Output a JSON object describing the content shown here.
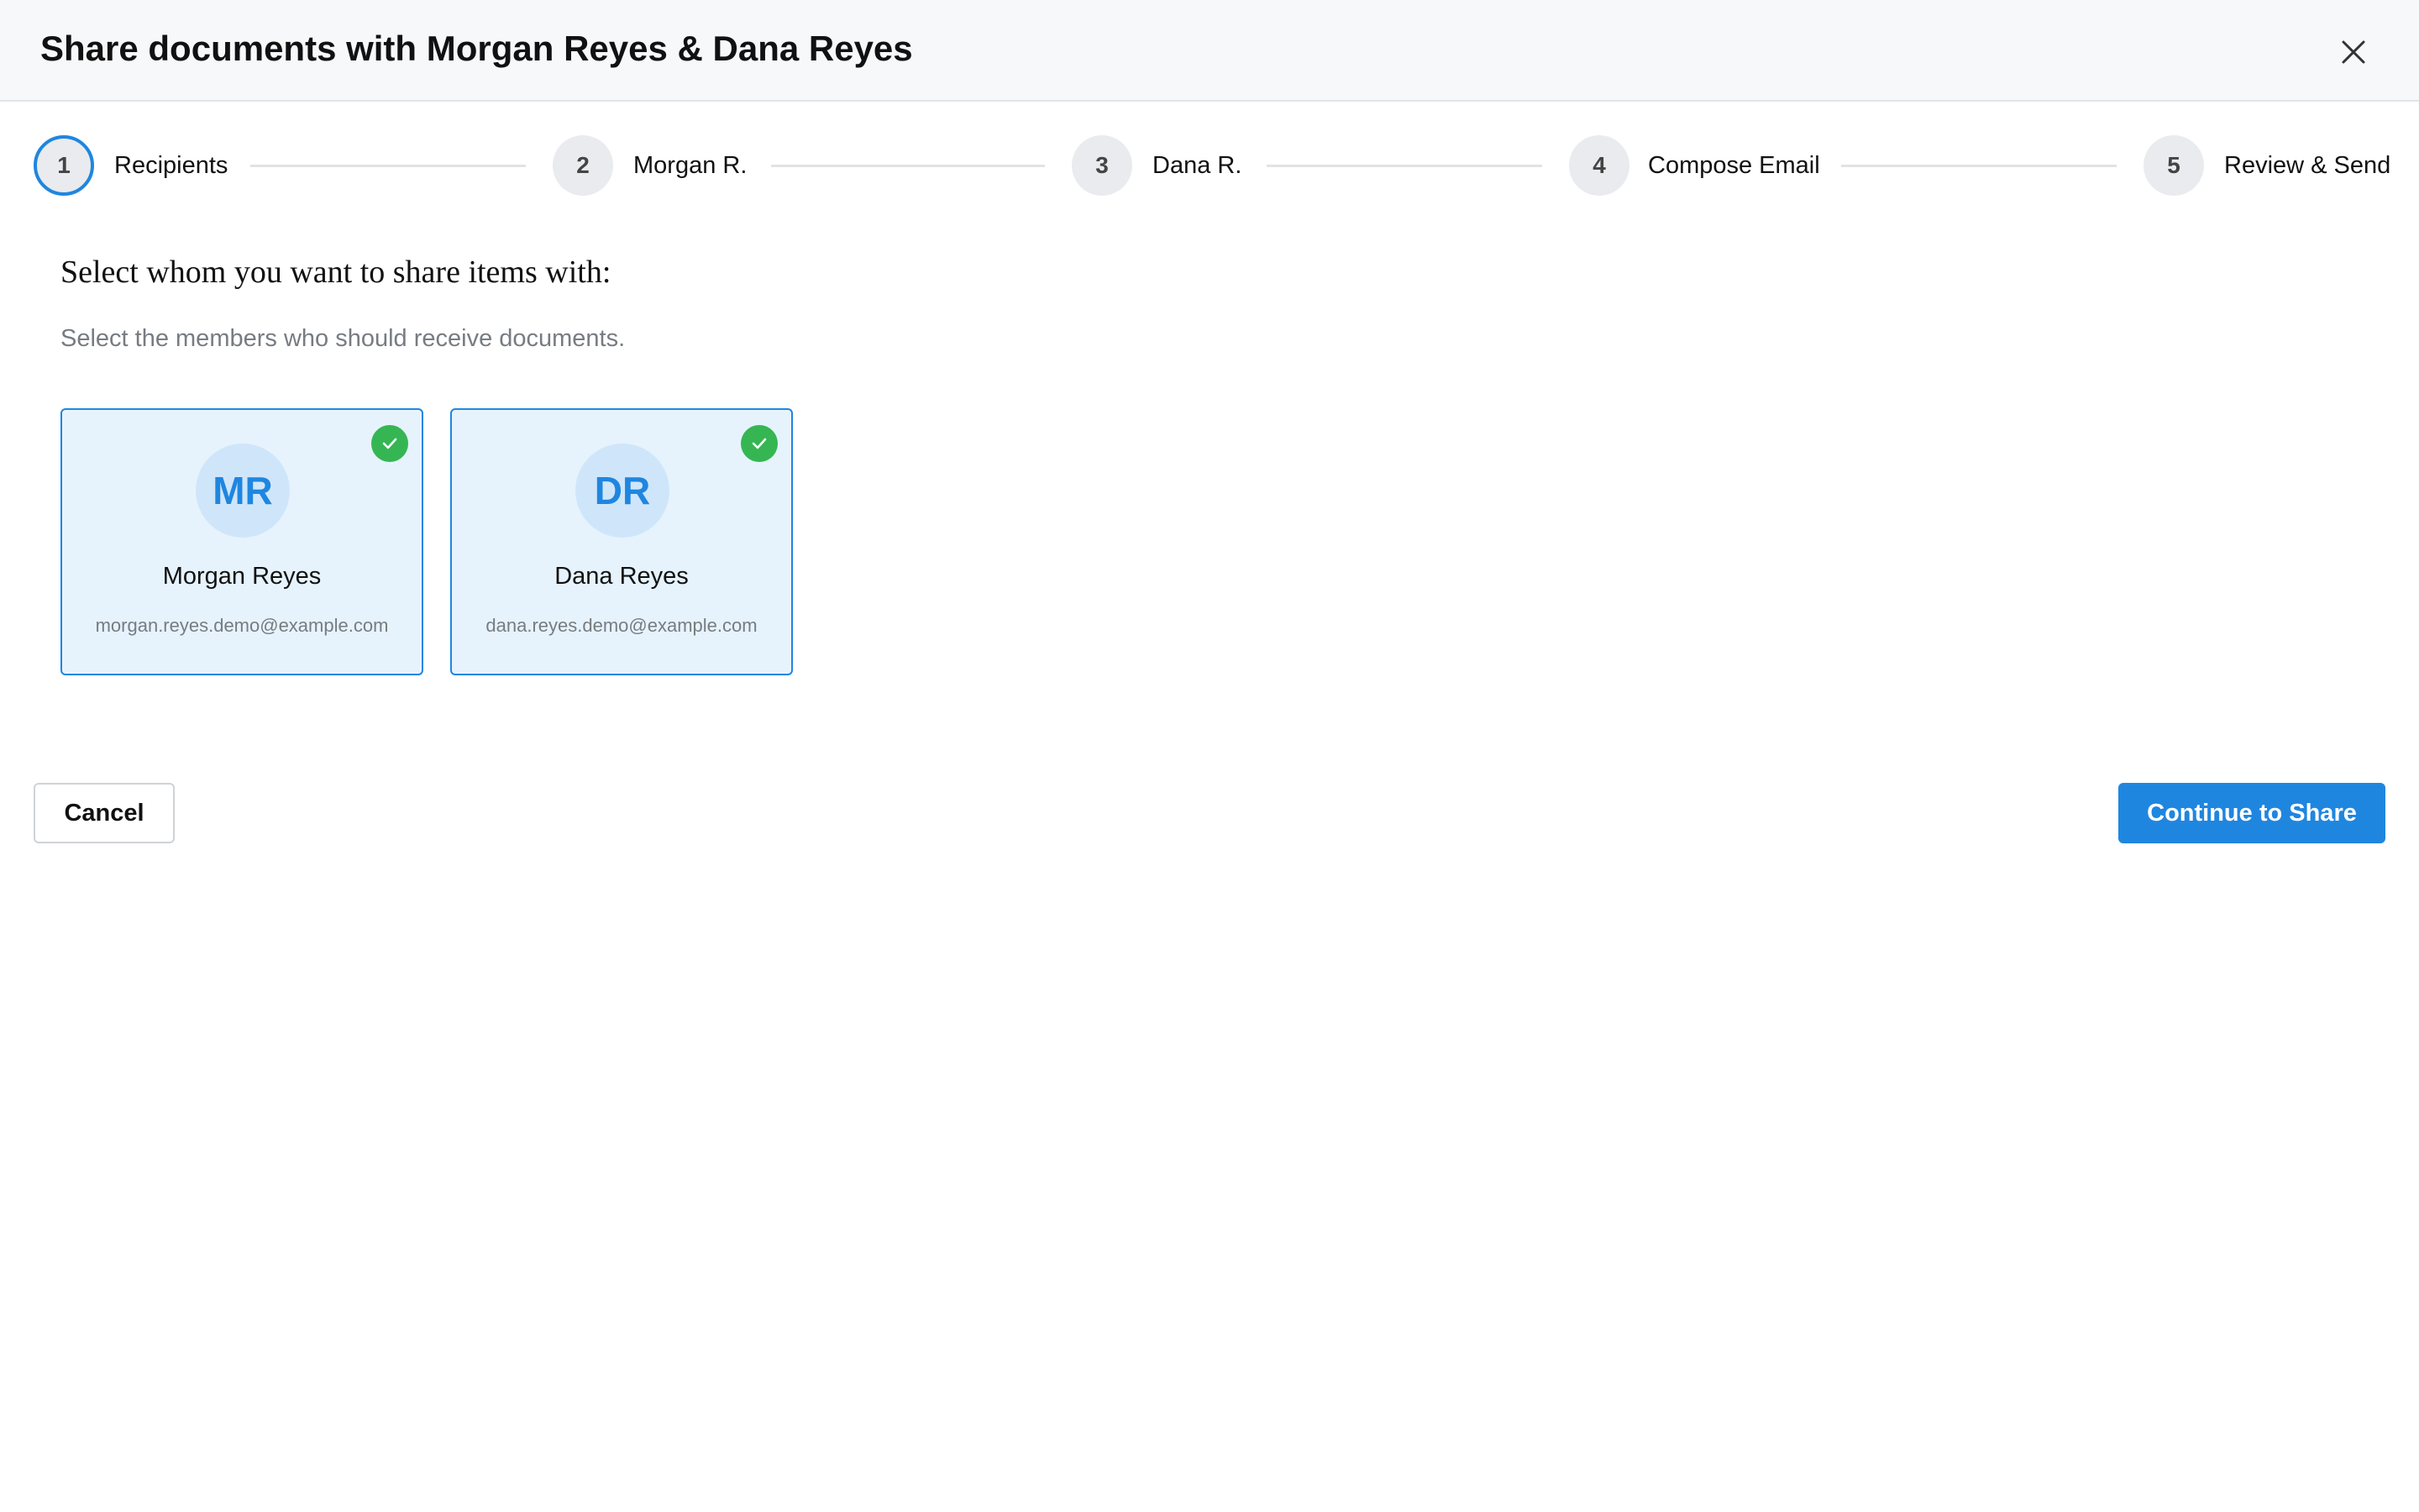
{
  "dialog": {
    "title": "Share documents with Morgan Reyes & Dana Reyes"
  },
  "steps": [
    {
      "number": "1",
      "label": "Recipients",
      "active": true
    },
    {
      "number": "2",
      "label": "Morgan R.",
      "active": false
    },
    {
      "number": "3",
      "label": "Dana R.",
      "active": false
    },
    {
      "number": "4",
      "label": "Compose Email",
      "active": false
    },
    {
      "number": "5",
      "label": "Review & Send",
      "active": false
    }
  ],
  "content": {
    "heading": "Select whom you want to share items with:",
    "subheading": "Select the members who should receive documents."
  },
  "recipients": [
    {
      "initials": "MR",
      "name": "Morgan Reyes",
      "email": "morgan.reyes.demo@example.com",
      "selected": true
    },
    {
      "initials": "DR",
      "name": "Dana Reyes",
      "email": "dana.reyes.demo@example.com",
      "selected": true
    }
  ],
  "footer": {
    "cancel_label": "Cancel",
    "continue_label": "Continue to Share"
  },
  "colors": {
    "accent": "#1f86e0",
    "selected_check": "#35b653",
    "card_background": "#e6f3fd"
  }
}
